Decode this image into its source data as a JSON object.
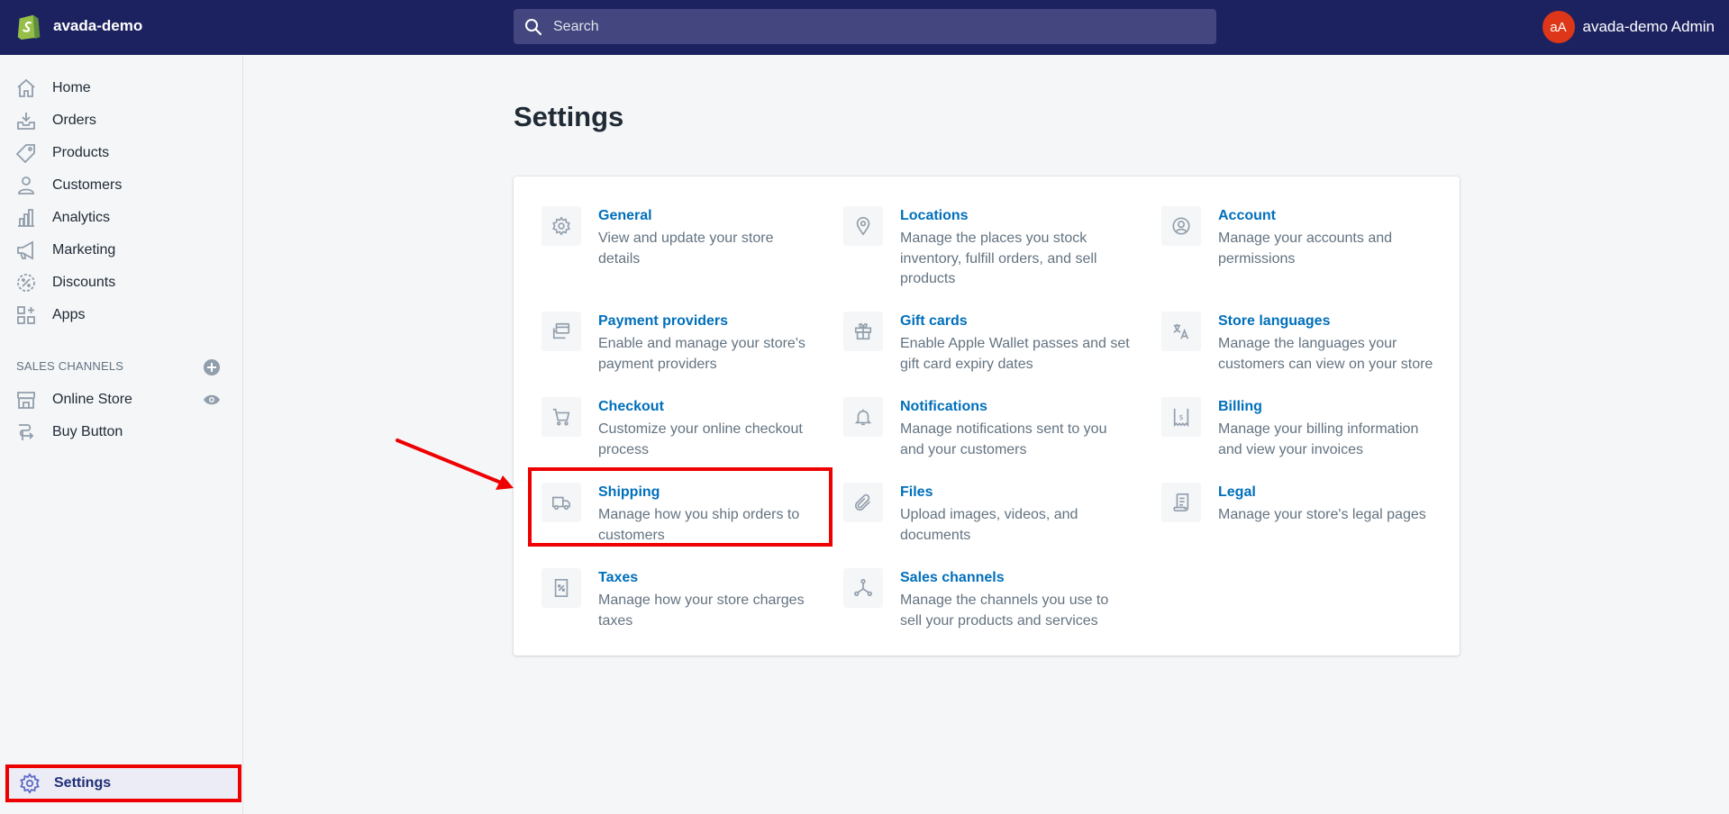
{
  "topbar": {
    "store_name": "avada-demo",
    "search_placeholder": "Search",
    "avatar_initials": "aA",
    "user_name": "avada-demo Admin"
  },
  "sidebar": {
    "items": [
      {
        "label": "Home",
        "icon": "home-icon"
      },
      {
        "label": "Orders",
        "icon": "orders-icon"
      },
      {
        "label": "Products",
        "icon": "tag-icon"
      },
      {
        "label": "Customers",
        "icon": "person-icon"
      },
      {
        "label": "Analytics",
        "icon": "bar-chart-icon"
      },
      {
        "label": "Marketing",
        "icon": "megaphone-icon"
      },
      {
        "label": "Discounts",
        "icon": "discount-icon"
      },
      {
        "label": "Apps",
        "icon": "apps-icon"
      }
    ],
    "sales_channels_heading": "SALES CHANNELS",
    "channels": [
      {
        "label": "Online Store",
        "icon": "store-icon"
      },
      {
        "label": "Buy Button",
        "icon": "buy-button-icon"
      }
    ],
    "settings_label": "Settings"
  },
  "main": {
    "title": "Settings",
    "tiles": [
      {
        "title": "General",
        "desc": "View and update your store details",
        "icon": "gear-icon"
      },
      {
        "title": "Locations",
        "desc": "Manage the places you stock inventory, fulfill orders, and sell products",
        "icon": "location-pin-icon"
      },
      {
        "title": "Account",
        "desc": "Manage your accounts and permissions",
        "icon": "account-circle-icon"
      },
      {
        "title": "Payment providers",
        "desc": "Enable and manage your store's payment providers",
        "icon": "credit-card-icon"
      },
      {
        "title": "Gift cards",
        "desc": "Enable Apple Wallet passes and set gift card expiry dates",
        "icon": "gift-icon"
      },
      {
        "title": "Store languages",
        "desc": "Manage the languages your customers can view on your store",
        "icon": "translate-icon"
      },
      {
        "title": "Checkout",
        "desc": "Customize your online checkout process",
        "icon": "cart-icon"
      },
      {
        "title": "Notifications",
        "desc": "Manage notifications sent to you and your customers",
        "icon": "bell-icon"
      },
      {
        "title": "Billing",
        "desc": "Manage your billing information and view your invoices",
        "icon": "billing-icon"
      },
      {
        "title": "Shipping",
        "desc": "Manage how you ship orders to customers",
        "icon": "truck-icon"
      },
      {
        "title": "Files",
        "desc": "Upload images, videos, and documents",
        "icon": "paperclip-icon"
      },
      {
        "title": "Legal",
        "desc": "Manage your store's legal pages",
        "icon": "document-icon"
      },
      {
        "title": "Taxes",
        "desc": "Manage how your store charges taxes",
        "icon": "tax-receipt-icon"
      },
      {
        "title": "Sales channels",
        "desc": "Manage the channels you use to sell your products and services",
        "icon": "channels-icon"
      }
    ]
  },
  "colors": {
    "topbar": "#1c2260",
    "link": "#006fbb",
    "annotation": "#ee0000",
    "avatar": "#de3618"
  }
}
